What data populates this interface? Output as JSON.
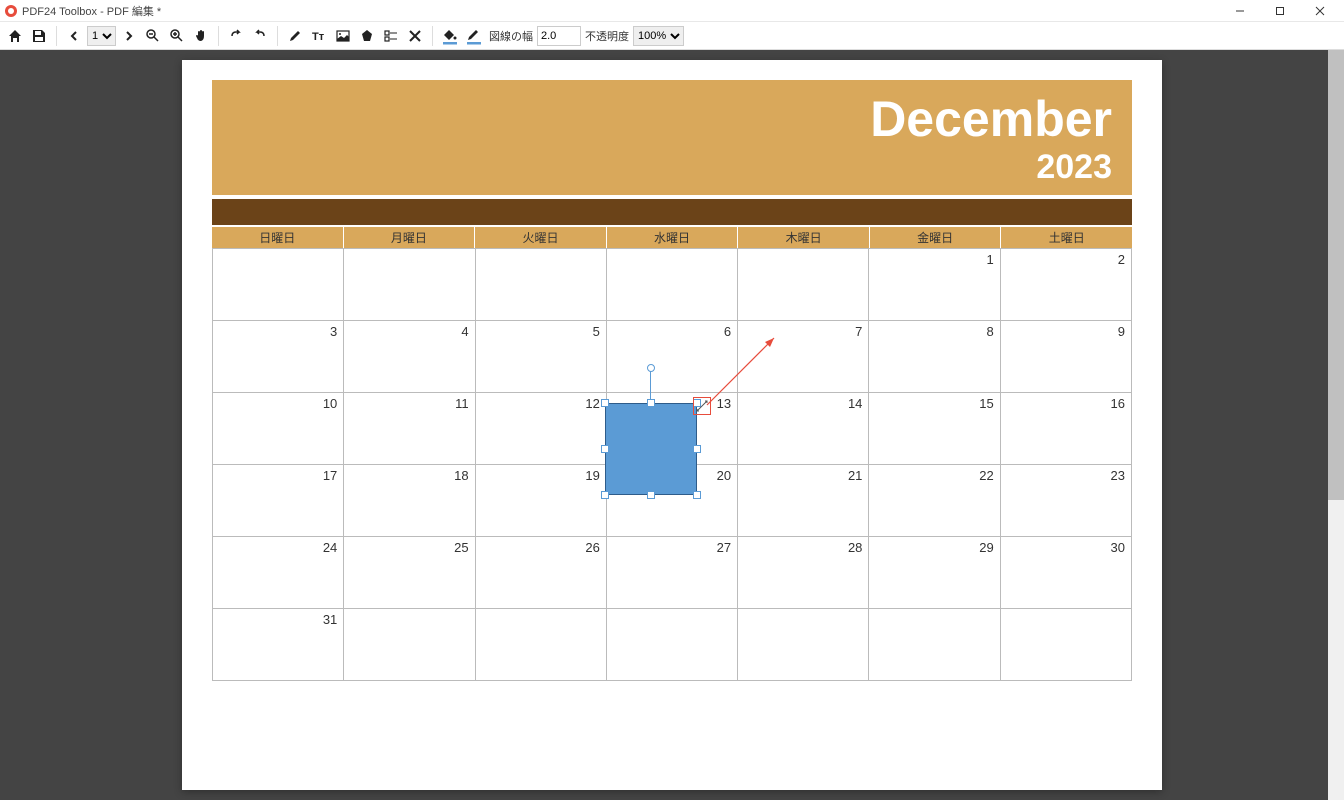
{
  "window": {
    "title": "PDF24 Toolbox - PDF 編集 *"
  },
  "toolbar": {
    "page_current": "1",
    "line_width_label": "図線の幅",
    "line_width_value": "2.0",
    "opacity_label": "不透明度",
    "opacity_value": "100%",
    "fill_color": "#5b9bd5",
    "stroke_color": "#5b9bd5"
  },
  "calendar": {
    "month": "December",
    "year": "2023",
    "day_headers": [
      "日曜日",
      "月曜日",
      "火曜日",
      "水曜日",
      "木曜日",
      "金曜日",
      "土曜日"
    ],
    "weeks": [
      [
        "",
        "",
        "",
        "",
        "",
        "1",
        "2"
      ],
      [
        "3",
        "4",
        "5",
        "6",
        "7",
        "8",
        "9"
      ],
      [
        "10",
        "11",
        "12",
        "13",
        "14",
        "15",
        "16"
      ],
      [
        "17",
        "18",
        "19",
        "20",
        "21",
        "22",
        "23"
      ],
      [
        "24",
        "25",
        "26",
        "27",
        "28",
        "29",
        "30"
      ],
      [
        "31",
        "",
        "",
        "",
        "",
        "",
        ""
      ]
    ]
  }
}
